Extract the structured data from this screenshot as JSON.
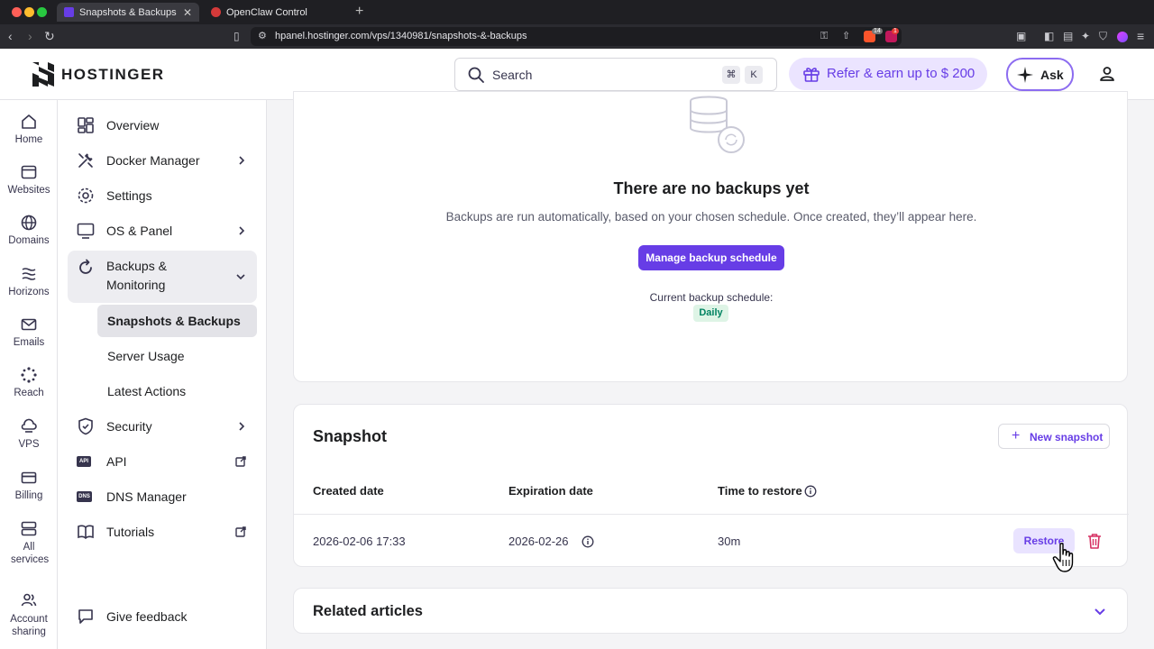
{
  "browser": {
    "tabs": [
      {
        "title": "Snapshots & Backups | Hostinger",
        "active": true
      },
      {
        "title": "OpenClaw Control",
        "active": false
      }
    ],
    "url": "hpanel.hostinger.com/vps/1340981/snapshots-&-backups",
    "badges": [
      "14",
      "1"
    ]
  },
  "header": {
    "logo": "HOSTINGER",
    "search_placeholder": "Search",
    "shortcut_keys": [
      "⌘",
      "K"
    ],
    "refer_label": "Refer & earn up to $ 200",
    "ask_label": "Ask"
  },
  "rail": [
    {
      "label": "Home",
      "icon": "home-icon"
    },
    {
      "label": "Websites",
      "icon": "websites-icon"
    },
    {
      "label": "Domains",
      "icon": "globe-icon"
    },
    {
      "label": "Horizons",
      "icon": "horizons-icon"
    },
    {
      "label": "Emails",
      "icon": "mail-icon"
    },
    {
      "label": "Reach",
      "icon": "reach-icon"
    },
    {
      "label": "VPS",
      "icon": "vps-icon"
    },
    {
      "label": "Billing",
      "icon": "card-icon"
    },
    {
      "label": "All services",
      "icon": "services-icon"
    },
    {
      "label": "Account sharing",
      "icon": "people-icon"
    }
  ],
  "sidebar": {
    "items": [
      {
        "label": "Overview"
      },
      {
        "label": "Docker Manager"
      },
      {
        "label": "Settings"
      },
      {
        "label": "OS & Panel"
      },
      {
        "label": "Backups & Monitoring"
      },
      {
        "label": "Security"
      },
      {
        "label": "API"
      },
      {
        "label": "DNS Manager"
      },
      {
        "label": "Tutorials"
      },
      {
        "label": "Give feedback"
      }
    ],
    "subitems": [
      {
        "label": "Snapshots & Backups",
        "active": true
      },
      {
        "label": "Server Usage"
      },
      {
        "label": "Latest Actions"
      }
    ]
  },
  "backups": {
    "empty_title": "There are no backups yet",
    "empty_description": "Backups are run automatically, based on your chosen schedule. Once created, they’ll appear here.",
    "manage_button": "Manage backup schedule",
    "schedule_label": "Current backup schedule:",
    "schedule_value": "Daily"
  },
  "snapshot": {
    "title": "Snapshot",
    "new_button": "New snapshot",
    "columns": [
      "Created date",
      "Expiration date",
      "Time to restore"
    ],
    "row": {
      "created": "2026-02-06 17:33",
      "expires": "2026-02-26",
      "restore_time": "30m",
      "restore_button": "Restore"
    }
  },
  "related": {
    "title": "Related articles"
  },
  "colors": {
    "accent": "#673de6",
    "success": "#008361",
    "danger": "#d63163"
  }
}
